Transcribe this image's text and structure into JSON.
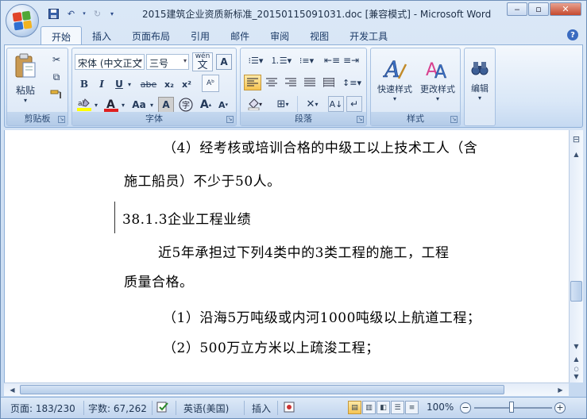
{
  "window": {
    "title": "2015建筑企业资质新标准_20150115091031.doc [兼容模式] - Microsoft Word",
    "minimize": "‒",
    "maximize": "▫",
    "close": "✕"
  },
  "tabs": [
    {
      "label": "开始",
      "active": true
    },
    {
      "label": "插入"
    },
    {
      "label": "页面布局"
    },
    {
      "label": "引用"
    },
    {
      "label": "邮件"
    },
    {
      "label": "审阅"
    },
    {
      "label": "视图"
    },
    {
      "label": "开发工具"
    }
  ],
  "ribbon": {
    "clipboard": {
      "paste_label": "粘贴",
      "group_label": "剪贴板"
    },
    "font": {
      "font_name": "宋体 (中文正文",
      "font_size": "三号",
      "group_label": "字体",
      "bold": "B",
      "italic": "I",
      "underline": "U",
      "strike": "abe",
      "subscript": "x₂",
      "superscript": "x²",
      "grow": "A",
      "shrink": "A",
      "case": "Aa",
      "clear": "A",
      "wen": "wén",
      "wen_char": "文"
    },
    "paragraph": {
      "group_label": "段落"
    },
    "styles": {
      "quick_styles": "快速样式",
      "change_styles": "更改样式",
      "group_label": "样式"
    },
    "editing": {
      "label": "编辑"
    }
  },
  "document": {
    "lines": [
      "（4）经考核或培训合格的中级工以上技术工人（含",
      "施工船员）不少于50人。",
      "38.1.3企业工程业绩",
      "近5年承担过下列4类中的3类工程的施工，工程",
      "质量合格。",
      "（1）沿海5万吨级或内河1000吨级以上航道工程；",
      "（2）500万立方米以上疏浚工程；"
    ]
  },
  "status": {
    "page": "页面: 183/230",
    "words": "字数: 67,262",
    "language": "英语(美国)",
    "insert_mode": "插入",
    "zoom": "100%"
  },
  "colors": {
    "accent": "#4a7fc1",
    "ribbon_bg": "#dbe7f6",
    "frame": "#c4d8f0"
  }
}
